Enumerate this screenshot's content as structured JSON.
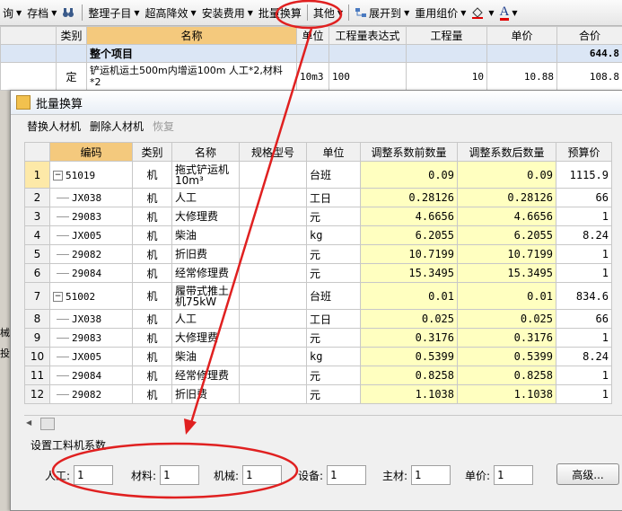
{
  "toolbar": {
    "items": [
      {
        "label": "询",
        "dd": true
      },
      {
        "label": "存档",
        "dd": true
      },
      {
        "label": "",
        "icon": "binoculars-icon"
      },
      {
        "label": "整理子目",
        "dd": true
      },
      {
        "label": "超高降效",
        "dd": true
      },
      {
        "label": "安装费用",
        "dd": true
      },
      {
        "label": "批量换算",
        "dd": false
      },
      {
        "label": "其他",
        "dd": true
      },
      {
        "label": "展开到",
        "dd": true,
        "icon": "tree-expand-icon"
      },
      {
        "label": "重用组价",
        "dd": true
      },
      {
        "label": "",
        "dd": true,
        "icon": "paint-bucket-icon"
      },
      {
        "label": "A",
        "dd": true,
        "icon": "font-color-icon"
      }
    ]
  },
  "bg_table": {
    "headers": [
      "类别",
      "名称",
      "单位",
      "工程量表达式",
      "工程量",
      "单价",
      "合价"
    ],
    "row1": {
      "name": "整个项目",
      "total": "644.8"
    },
    "row2": {
      "type": "定",
      "name": "铲运机运土500m内增运100m    人工*2,材料*2",
      "unit": "10m3",
      "expr": "100",
      "qty": "10",
      "price": "10.88",
      "total": "108.8"
    }
  },
  "side_labels": [
    "械",
    "投"
  ],
  "dialog": {
    "title": "批量换算",
    "toolbar": [
      "替换人材机",
      "删除人材机",
      "恢复"
    ],
    "headers": [
      "编码",
      "类别",
      "名称",
      "规格型号",
      "单位",
      "调整系数前数量",
      "调整系数后数量",
      "预算价"
    ],
    "rows": [
      {
        "n": "1",
        "code": "51019",
        "parent": true,
        "type": "机",
        "name": "拖式铲运机10m³",
        "spec": "",
        "unit": "台班",
        "before": "0.09",
        "after": "0.09",
        "price": "1115.9"
      },
      {
        "n": "2",
        "code": "JX038",
        "parent": false,
        "type": "机",
        "name": "人工",
        "spec": "",
        "unit": "工日",
        "before": "0.28126",
        "after": "0.28126",
        "price": "66"
      },
      {
        "n": "3",
        "code": "29083",
        "parent": false,
        "type": "机",
        "name": "大修理费",
        "spec": "",
        "unit": "元",
        "before": "4.6656",
        "after": "4.6656",
        "price": "1"
      },
      {
        "n": "4",
        "code": "JX005",
        "parent": false,
        "type": "机",
        "name": "柴油",
        "spec": "",
        "unit": "kg",
        "before": "6.2055",
        "after": "6.2055",
        "price": "8.24"
      },
      {
        "n": "5",
        "code": "29082",
        "parent": false,
        "type": "机",
        "name": "折旧费",
        "spec": "",
        "unit": "元",
        "before": "10.7199",
        "after": "10.7199",
        "price": "1"
      },
      {
        "n": "6",
        "code": "29084",
        "parent": false,
        "type": "机",
        "name": "经常修理费",
        "spec": "",
        "unit": "元",
        "before": "15.3495",
        "after": "15.3495",
        "price": "1"
      },
      {
        "n": "7",
        "code": "51002",
        "parent": true,
        "type": "机",
        "name": "履带式推土机75kW",
        "spec": "",
        "unit": "台班",
        "before": "0.01",
        "after": "0.01",
        "price": "834.6"
      },
      {
        "n": "8",
        "code": "JX038",
        "parent": false,
        "type": "机",
        "name": "人工",
        "spec": "",
        "unit": "工日",
        "before": "0.025",
        "after": "0.025",
        "price": "66"
      },
      {
        "n": "9",
        "code": "29083",
        "parent": false,
        "type": "机",
        "name": "大修理费",
        "spec": "",
        "unit": "元",
        "before": "0.3176",
        "after": "0.3176",
        "price": "1"
      },
      {
        "n": "10",
        "code": "JX005",
        "parent": false,
        "type": "机",
        "name": "柴油",
        "spec": "",
        "unit": "kg",
        "before": "0.5399",
        "after": "0.5399",
        "price": "8.24"
      },
      {
        "n": "11",
        "code": "29084",
        "parent": false,
        "type": "机",
        "name": "经常修理费",
        "spec": "",
        "unit": "元",
        "before": "0.8258",
        "after": "0.8258",
        "price": "1"
      },
      {
        "n": "12",
        "code": "29082",
        "parent": false,
        "type": "机",
        "name": "折旧费",
        "spec": "",
        "unit": "元",
        "before": "1.1038",
        "after": "1.1038",
        "price": "1"
      }
    ],
    "section_label": "设置工料机系数",
    "coefficients": [
      {
        "label": "人工:",
        "value": "1"
      },
      {
        "label": "材料:",
        "value": "1"
      },
      {
        "label": "机械:",
        "value": "1"
      },
      {
        "label": "设备:",
        "value": "1"
      },
      {
        "label": "主材:",
        "value": "1"
      },
      {
        "label": "单价:",
        "value": "1"
      }
    ],
    "advanced_button": "高级..."
  },
  "colors": {
    "annotation": "#e02020",
    "header_highlight": "#f4c97d",
    "input_cell": "#ffffc0"
  }
}
